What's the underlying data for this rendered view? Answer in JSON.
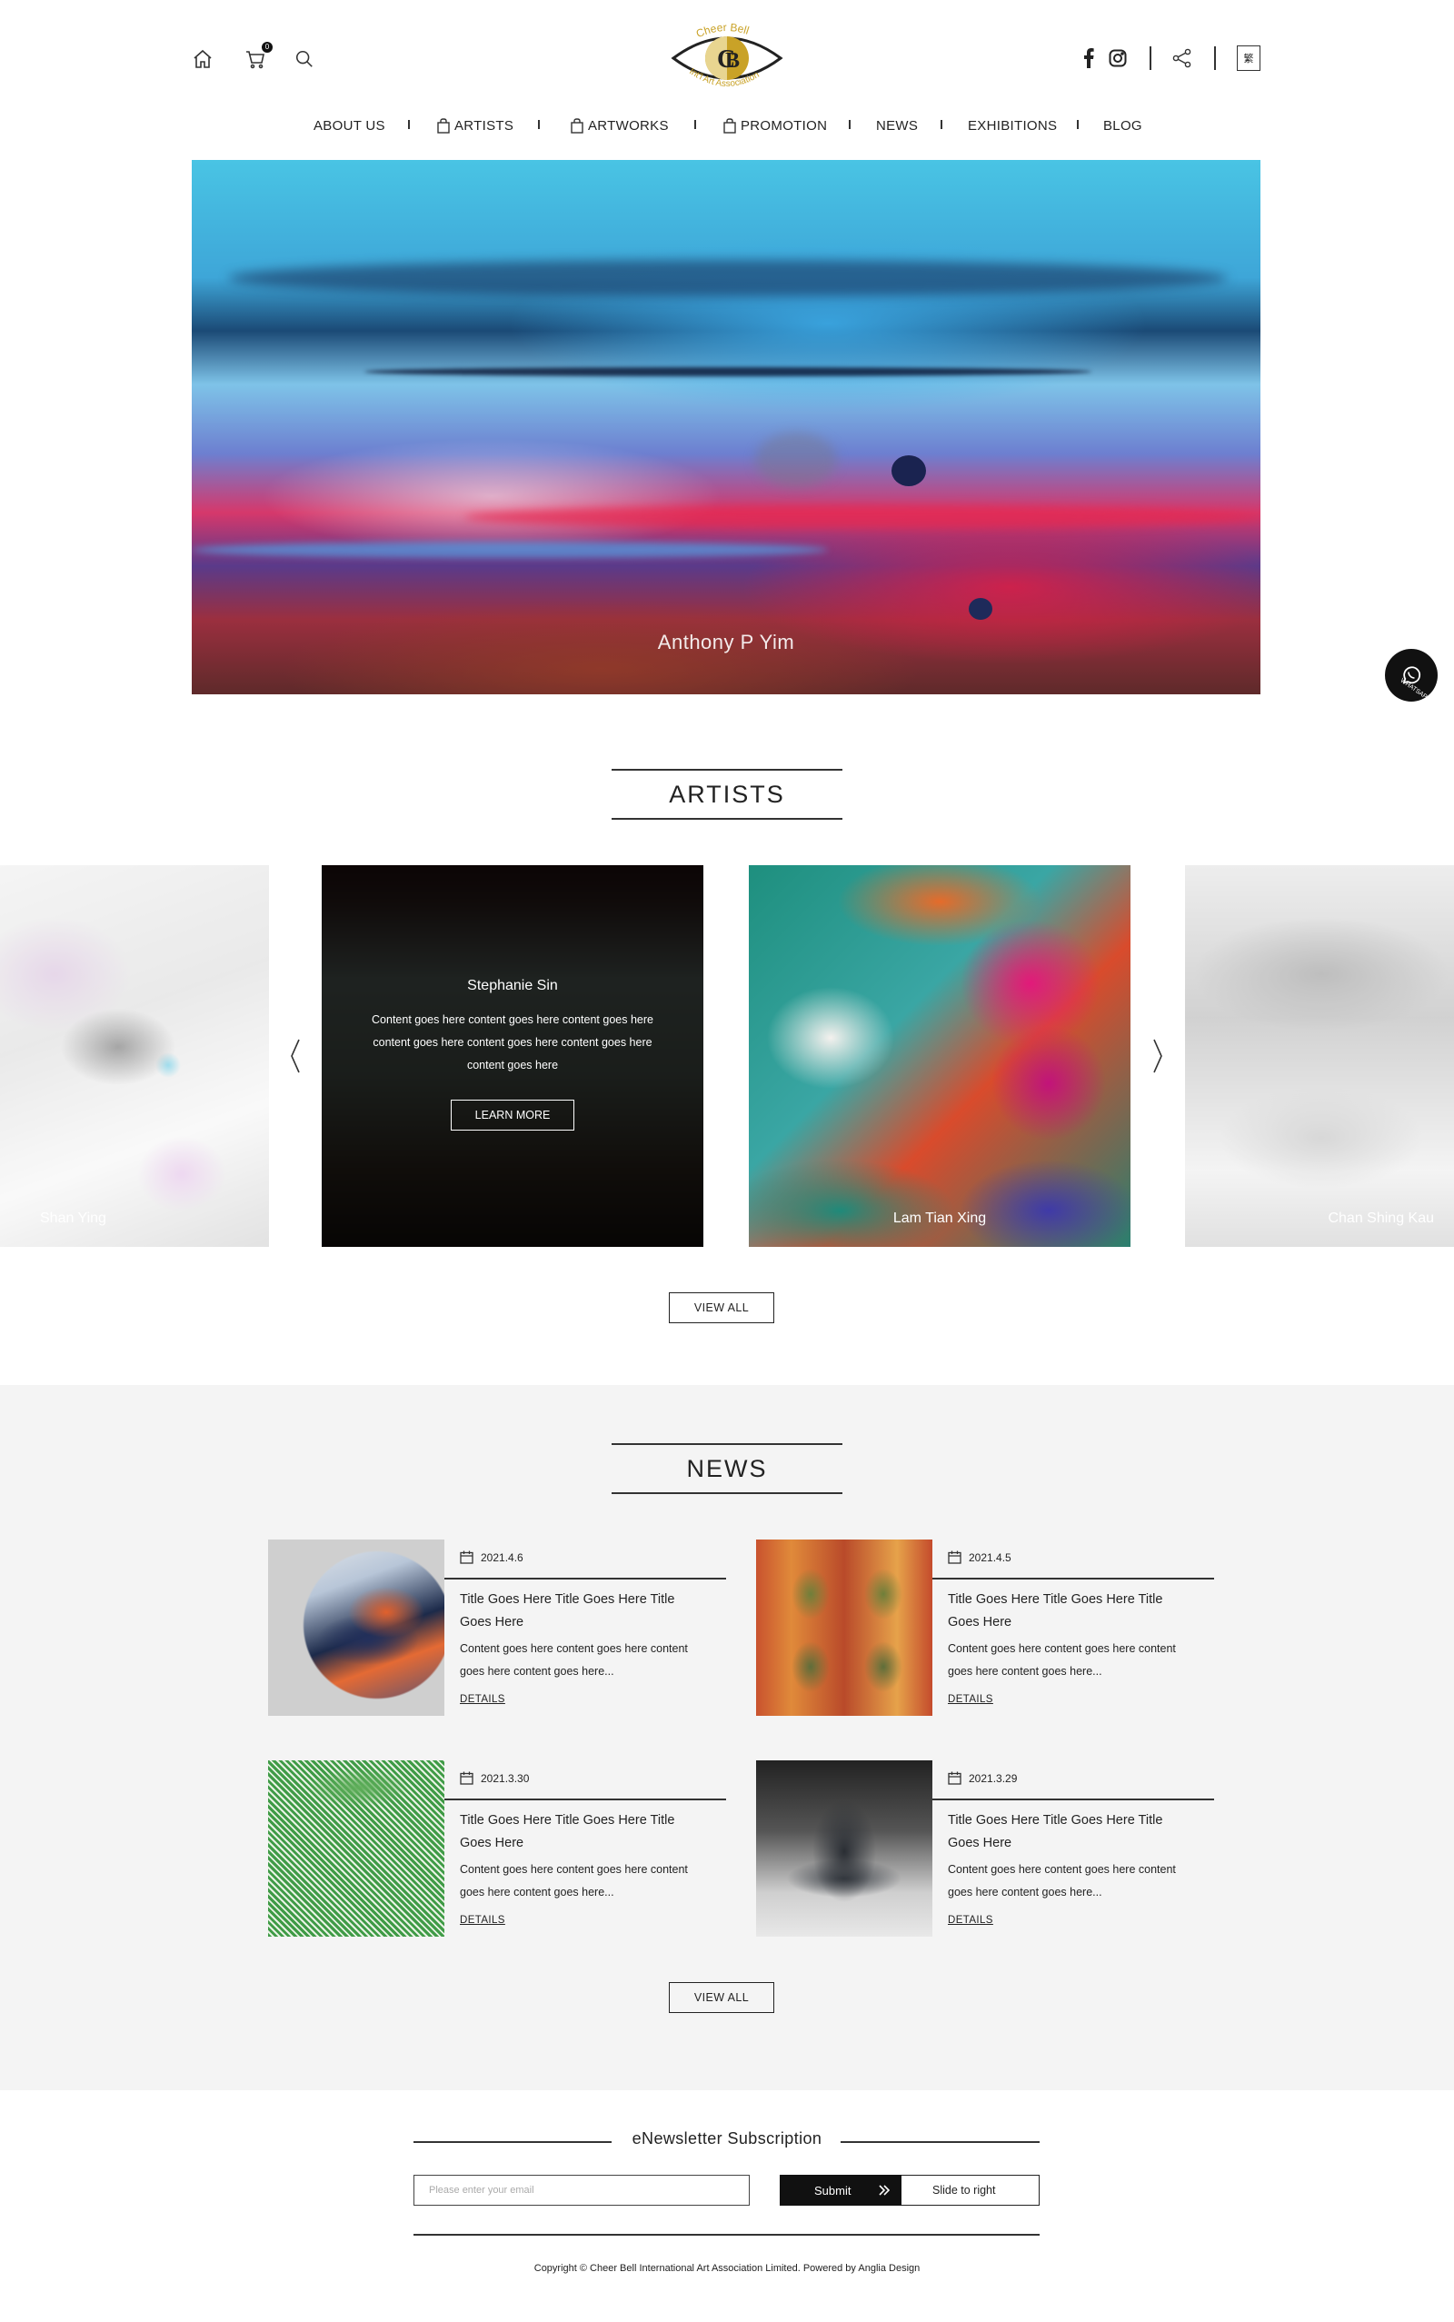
{
  "header": {
    "cart_count": "0",
    "lang_label": "繁",
    "logo_text_top": "Cheer   Bell",
    "logo_text_bottom": "Int'l Art Association",
    "logo_gold": "#c9a227"
  },
  "nav": {
    "items": [
      {
        "label": "ABOUT US"
      },
      {
        "label": "ARTISTS"
      },
      {
        "label": "ARTWORKS"
      },
      {
        "label": "PROMOTION"
      },
      {
        "label": "NEWS"
      },
      {
        "label": "EXHIBITIONS"
      },
      {
        "label": "BLOG"
      }
    ]
  },
  "hero": {
    "caption": "Anthony P Yim"
  },
  "whatsapp": {
    "label": "WHATSAPP"
  },
  "artists": {
    "title": "ARTISTS",
    "cards": [
      {
        "name": "Shan Ying"
      },
      {
        "name": "Stephanie Sin",
        "content": "Content goes here content goes here content goes here content goes here content goes here content goes here content goes here",
        "button": "LEARN MORE"
      },
      {
        "name": "Lam Tian Xing"
      },
      {
        "name": "Chan Shing Kau"
      }
    ],
    "view_all": "VIEW ALL"
  },
  "news": {
    "title": "NEWS",
    "items": [
      {
        "date": "2021.4.6",
        "title": "Title Goes Here Title Goes Here Title Goes Here",
        "content": "Content goes here content goes here content goes here content goes here...",
        "details": "DETAILS"
      },
      {
        "date": "2021.4.5",
        "title": "Title Goes Here Title Goes Here Title Goes Here",
        "content": "Content goes here content goes here content goes here content goes here...",
        "details": "DETAILS"
      },
      {
        "date": "2021.3.30",
        "title": "Title Goes Here Title Goes Here Title Goes Here",
        "content": "Content goes here content goes here content goes here content goes here...",
        "details": "DETAILS"
      },
      {
        "date": "2021.3.29",
        "title": "Title Goes Here Title Goes Here Title Goes Here",
        "content": "Content goes here content goes here content goes here content goes here...",
        "details": "DETAILS"
      }
    ],
    "view_all": "VIEW ALL"
  },
  "newsletter": {
    "title": "eNewsletter Subscription",
    "placeholder": "Please enter your email",
    "submit": "Submit",
    "slide": "Slide to right"
  },
  "footer": {
    "copyright": "Copyright © Cheer Bell International Art Association Limited. Powered by Anglia Design"
  }
}
